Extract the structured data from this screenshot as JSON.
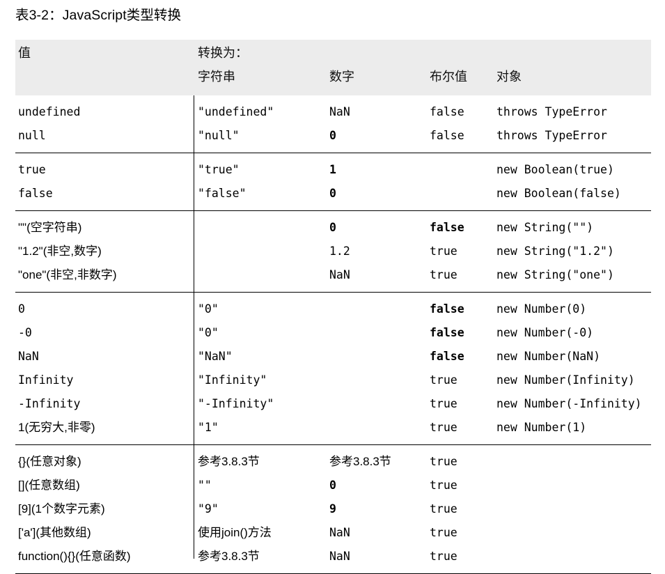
{
  "caption": "表3-2：JavaScript类型转换",
  "table": {
    "headers": {
      "value": "值",
      "convert_to": "转换为：",
      "string": "字符串",
      "number": "数字",
      "boolean": "布尔值",
      "object": "对象"
    },
    "groups": [
      {
        "name": "primitives-undefined-null",
        "rows": [
          {
            "value": "undefined",
            "string": "\"undefined\"",
            "number": "NaN",
            "boolean": "false",
            "object": "throws TypeError",
            "bold": []
          },
          {
            "value": "null",
            "string": "\"null\"",
            "number": "0",
            "boolean": "false",
            "object": "throws TypeError",
            "bold": [
              "number"
            ]
          }
        ]
      },
      {
        "name": "booleans",
        "rows": [
          {
            "value": "true",
            "string": "\"true\"",
            "number": "1",
            "boolean": "",
            "object": "new Boolean(true)",
            "bold": [
              "number"
            ]
          },
          {
            "value": "false",
            "string": "\"false\"",
            "number": "0",
            "boolean": "",
            "object": "new Boolean(false)",
            "bold": [
              "number"
            ]
          }
        ]
      },
      {
        "name": "strings",
        "rows": [
          {
            "value": "\"\"(空字符串)",
            "string": "",
            "number": "0",
            "boolean": "false",
            "object": "new String(\"\")",
            "bold": [
              "number",
              "boolean"
            ]
          },
          {
            "value": "\"1.2\"(非空,数字)",
            "string": "",
            "number": "1.2",
            "boolean": "true",
            "object": "new String(\"1.2\")",
            "bold": []
          },
          {
            "value": "\"one\"(非空,非数字)",
            "string": "",
            "number": "NaN",
            "boolean": "true",
            "object": "new String(\"one\")",
            "bold": []
          }
        ]
      },
      {
        "name": "numbers",
        "rows": [
          {
            "value": "0",
            "string": "\"0\"",
            "number": "",
            "boolean": "false",
            "object": "new Number(0)",
            "bold": [
              "boolean"
            ]
          },
          {
            "value": "-0",
            "string": "\"0\"",
            "number": "",
            "boolean": "false",
            "object": "new Number(-0)",
            "bold": [
              "boolean"
            ]
          },
          {
            "value": "NaN",
            "string": "\"NaN\"",
            "number": "",
            "boolean": "false",
            "object": "new Number(NaN)",
            "bold": [
              "boolean"
            ]
          },
          {
            "value": "Infinity",
            "string": "\"Infinity\"",
            "number": "",
            "boolean": "true",
            "object": "new Number(Infinity)",
            "bold": []
          },
          {
            "value": "-Infinity",
            "string": "\"-Infinity\"",
            "number": "",
            "boolean": "true",
            "object": "new Number(-Infinity)",
            "bold": []
          },
          {
            "value": "1(无穷大,非零)",
            "string": "\"1\"",
            "number": "",
            "boolean": "true",
            "object": "new Number(1)",
            "bold": []
          }
        ]
      },
      {
        "name": "objects",
        "rows": [
          {
            "value": "{}(任意对象)",
            "string": "参考3.8.3节",
            "number": "参考3.8.3节",
            "boolean": "true",
            "object": "",
            "bold": []
          },
          {
            "value": "[](任意数组)",
            "string": "\"\"",
            "number": "0",
            "boolean": "true",
            "object": "",
            "bold": [
              "number"
            ]
          },
          {
            "value": "[9](1个数字元素)",
            "string": "\"9\"",
            "number": "9",
            "boolean": "true",
            "object": "",
            "bold": [
              "number"
            ]
          },
          {
            "value": "['a'](其他数组)",
            "string": "使用join()方法",
            "number": "NaN",
            "boolean": "true",
            "object": "",
            "bold": []
          },
          {
            "value": "function(){}(任意函数)",
            "string": "参考3.8.3节",
            "number": "NaN",
            "boolean": "true",
            "object": "",
            "bold": []
          }
        ]
      }
    ]
  },
  "colors": {
    "header_background": "#ececec",
    "rule": "#000000",
    "text": "#000000",
    "page_background": "#ffffff"
  }
}
